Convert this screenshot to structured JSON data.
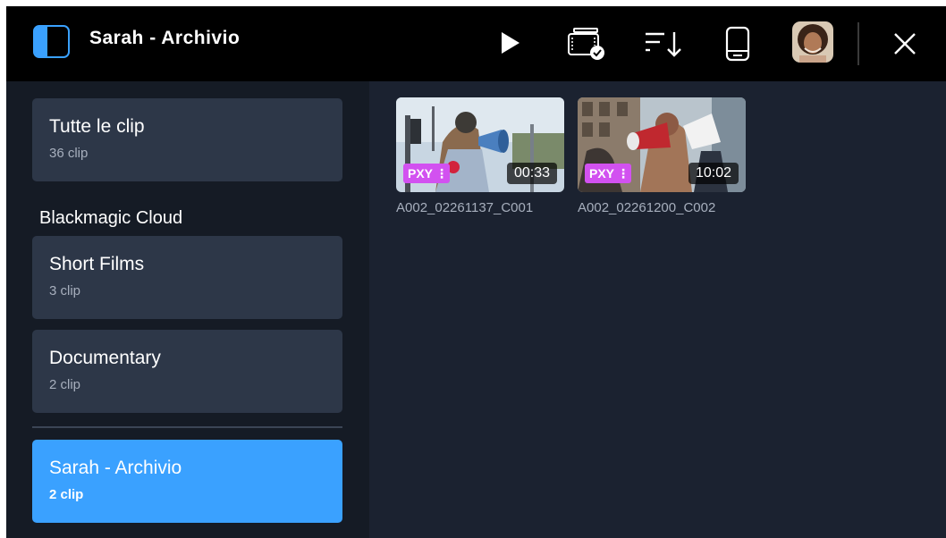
{
  "header": {
    "title": "Sarah - Archivio",
    "icons": [
      "sidebar-toggle-icon",
      "play-icon",
      "media-card-check-icon",
      "sort-icon",
      "storage-drive-icon",
      "user-avatar",
      "close-icon"
    ],
    "accent_color": "#3aa1ff"
  },
  "sidebar": {
    "all_clips": {
      "label": "Tutte le clip",
      "count": "36 clip"
    },
    "section_label": "Blackmagic Cloud",
    "projects": [
      {
        "label": "Short Films",
        "count": "3 clip"
      },
      {
        "label": "Documentary",
        "count": "2 clip"
      }
    ],
    "active_project": {
      "label": "Sarah - Archivio",
      "count": "2 clip"
    }
  },
  "clips": [
    {
      "name": "A002_02261137_C001",
      "duration": "00:33",
      "badge": "PXY"
    },
    {
      "name": "A002_02261200_C002",
      "duration": "10:02",
      "badge": "PXY"
    }
  ],
  "colors": {
    "badge": "#d251f0",
    "active_card": "#3aa1ff",
    "card": "#2d3748"
  }
}
